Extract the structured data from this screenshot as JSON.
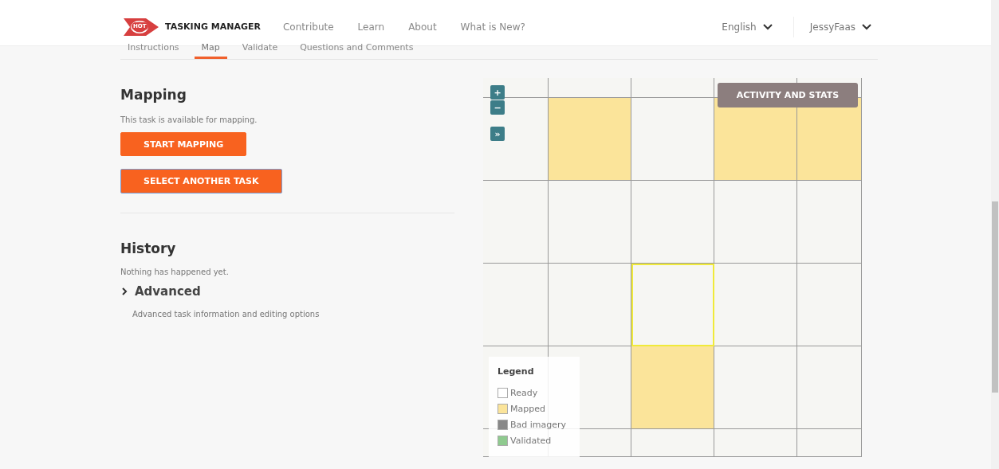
{
  "header": {
    "brand": "TASKING MANAGER",
    "logo_text": "HOT",
    "nav": [
      "Contribute",
      "Learn",
      "About",
      "What is New?"
    ],
    "language": "English",
    "user": "JessyFaas"
  },
  "tabs": [
    {
      "label": "Instructions",
      "selected": false
    },
    {
      "label": "Map",
      "selected": true
    },
    {
      "label": "Validate",
      "selected": false
    },
    {
      "label": "Questions and Comments",
      "selected": false
    }
  ],
  "mapping": {
    "title": "Mapping",
    "text": "This task is available for mapping.",
    "buttons": [
      {
        "label": "START MAPPING",
        "focused": false
      },
      {
        "label": "SELECT ANOTHER TASK",
        "focused": true
      }
    ]
  },
  "history": {
    "title": "History",
    "text": "Nothing has happened yet.",
    "advanced": {
      "label": "Advanced",
      "expanded": false,
      "text": "Advanced task information and editing options"
    }
  },
  "map": {
    "controls": [
      "+",
      "−",
      "»"
    ],
    "activity_button": "ACTIVITY AND STATS",
    "tiles": [
      [
        {
          "mapped": false,
          "selected": false
        },
        {
          "mapped": false,
          "selected": false
        },
        {
          "mapped": false,
          "selected": false
        },
        {
          "mapped": false,
          "selected": false
        },
        {
          "mapped": false,
          "selected": false
        }
      ],
      [
        {
          "mapped": false,
          "selected": false
        },
        {
          "mapped": true,
          "selected": false
        },
        {
          "mapped": false,
          "selected": false
        },
        {
          "mapped": true,
          "selected": false
        },
        {
          "mapped": true,
          "selected": false
        }
      ],
      [
        {
          "mapped": false,
          "selected": false
        },
        {
          "mapped": false,
          "selected": false
        },
        {
          "mapped": false,
          "selected": false
        },
        {
          "mapped": false,
          "selected": false
        },
        {
          "mapped": false,
          "selected": false
        }
      ],
      [
        {
          "mapped": false,
          "selected": false
        },
        {
          "mapped": false,
          "selected": false
        },
        {
          "mapped": false,
          "selected": true
        },
        {
          "mapped": false,
          "selected": false
        },
        {
          "mapped": false,
          "selected": false
        }
      ],
      [
        {
          "mapped": false,
          "selected": false
        },
        {
          "mapped": false,
          "selected": false
        },
        {
          "mapped": true,
          "selected": false
        },
        {
          "mapped": false,
          "selected": false
        },
        {
          "mapped": false,
          "selected": false
        }
      ],
      [
        {
          "mapped": false,
          "selected": false
        },
        {
          "mapped": false,
          "selected": false
        },
        {
          "mapped": false,
          "selected": false
        },
        {
          "mapped": false,
          "selected": false
        },
        {
          "mapped": false,
          "selected": false
        }
      ]
    ],
    "legend": {
      "title": "Legend",
      "items": [
        {
          "label": "Ready",
          "color": "#ffffff"
        },
        {
          "label": "Mapped",
          "color": "#fbe49a"
        },
        {
          "label": "Bad imagery",
          "color": "#888888"
        },
        {
          "label": "Validated",
          "color": "#8fca8f"
        }
      ]
    }
  }
}
